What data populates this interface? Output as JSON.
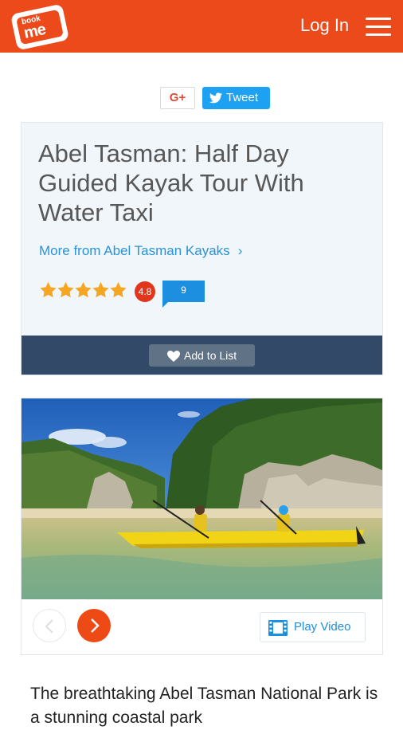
{
  "header": {
    "logo_top": "book",
    "logo_main": "me",
    "login_label": "Log In",
    "menu_icon": "hamburger-menu-icon",
    "brand_color": "#ed4a1c"
  },
  "social": {
    "gplus_label": "G+",
    "tweet_label": "Tweet"
  },
  "listing": {
    "title": "Abel Tasman: Half Day Guided Kayak Tour With Water Taxi",
    "more_from": "More from Abel Tasman Kayaks",
    "more_chevron": "›",
    "stars": 5,
    "rating": "4.8",
    "review_count": "9",
    "add_to_list": "Add to List"
  },
  "gallery": {
    "play_video": "Play Video",
    "prev_icon": "chevron-left-icon",
    "next_icon": "chevron-right-icon"
  },
  "description": {
    "text": "The breathtaking Abel Tasman National Park is a stunning coastal park"
  }
}
